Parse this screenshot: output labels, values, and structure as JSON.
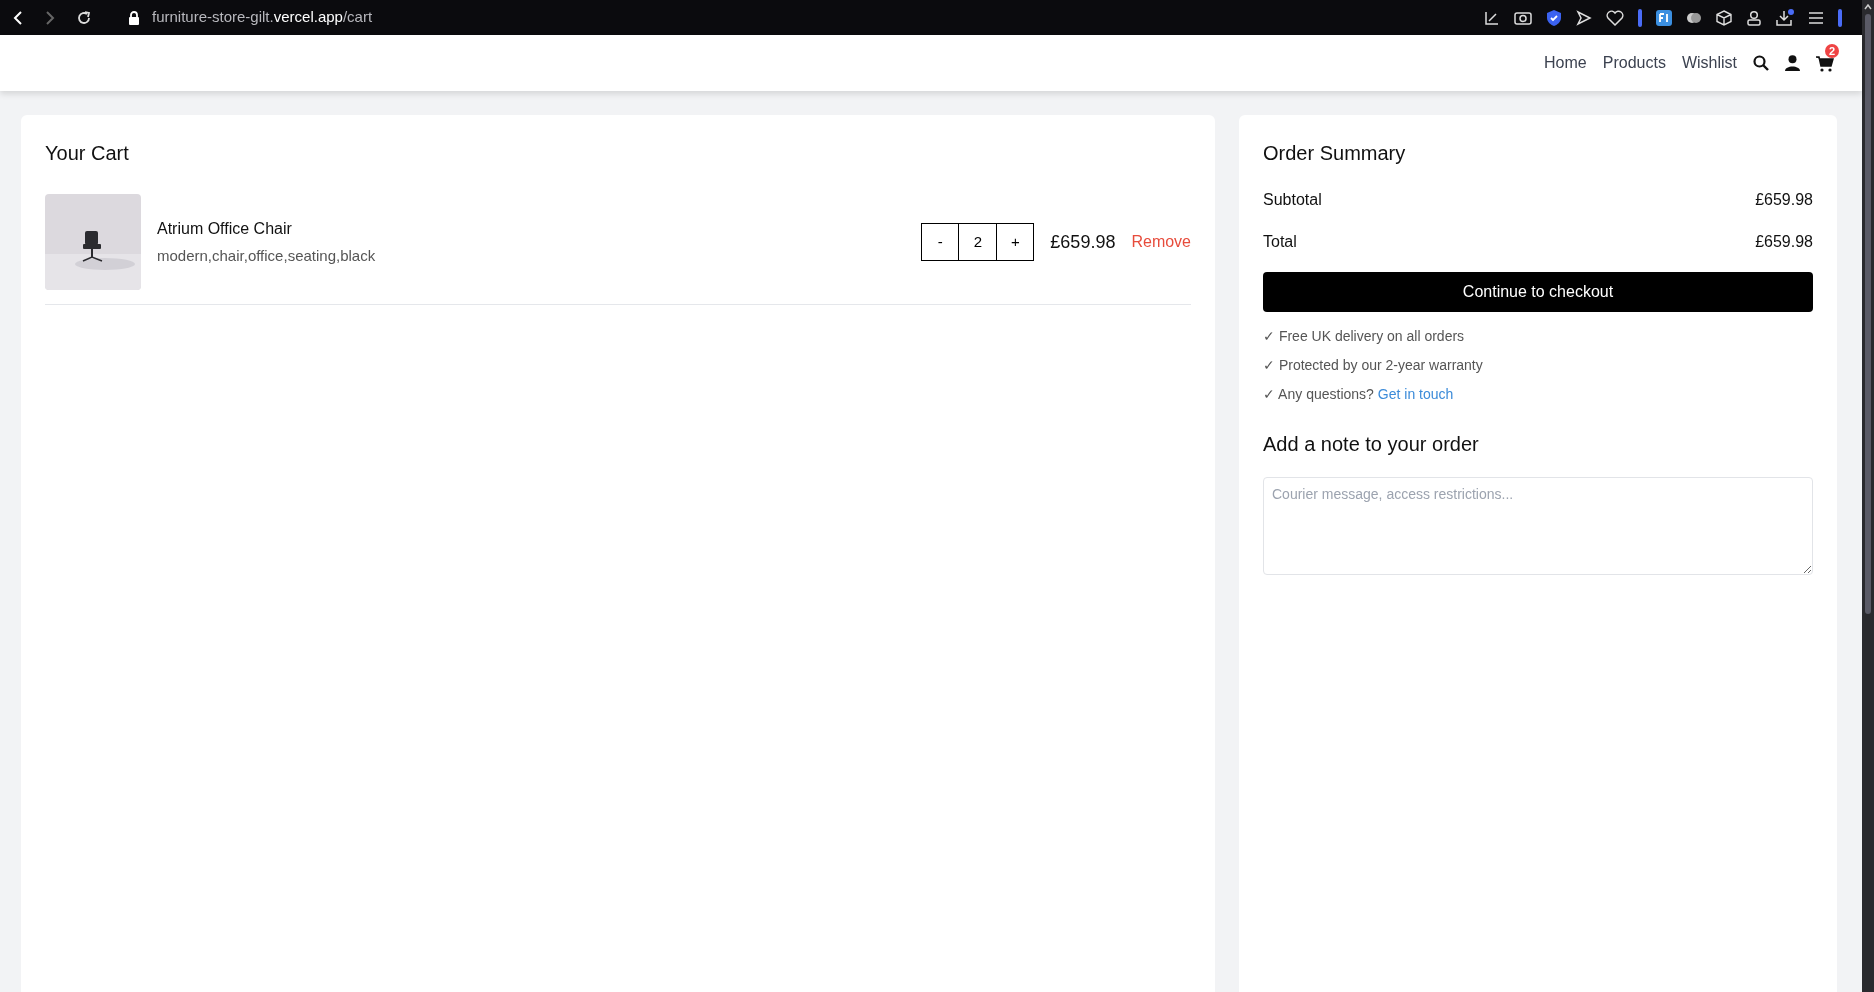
{
  "browser": {
    "url_host_prefix": "furniture-store-gilt.",
    "url_host_main": "vercel.app",
    "url_path": "/cart"
  },
  "nav": {
    "links": [
      {
        "label": "Home"
      },
      {
        "label": "Products"
      },
      {
        "label": "Wishlist"
      }
    ],
    "cart_count": "2"
  },
  "cart": {
    "title": "Your Cart",
    "items": [
      {
        "name": "Atrium Office Chair",
        "tags": "modern,chair,office,seating,black",
        "decrease": "-",
        "quantity": "2",
        "increase": "+",
        "price": "£659.98",
        "remove": "Remove"
      }
    ]
  },
  "summary": {
    "title": "Order Summary",
    "lines": [
      {
        "label": "Subtotal",
        "value": "£659.98"
      },
      {
        "label": "Total",
        "value": "£659.98"
      }
    ],
    "checkout": "Continue to checkout",
    "perks": [
      {
        "text": "✓ Free UK delivery on all orders"
      },
      {
        "text": "✓ Protected by our 2-year warranty"
      },
      {
        "text": "✓ Any questions?",
        "link": "Get in touch"
      }
    ],
    "note_title": "Add a note to your order",
    "note_placeholder": "Courier message, access restrictions..."
  }
}
